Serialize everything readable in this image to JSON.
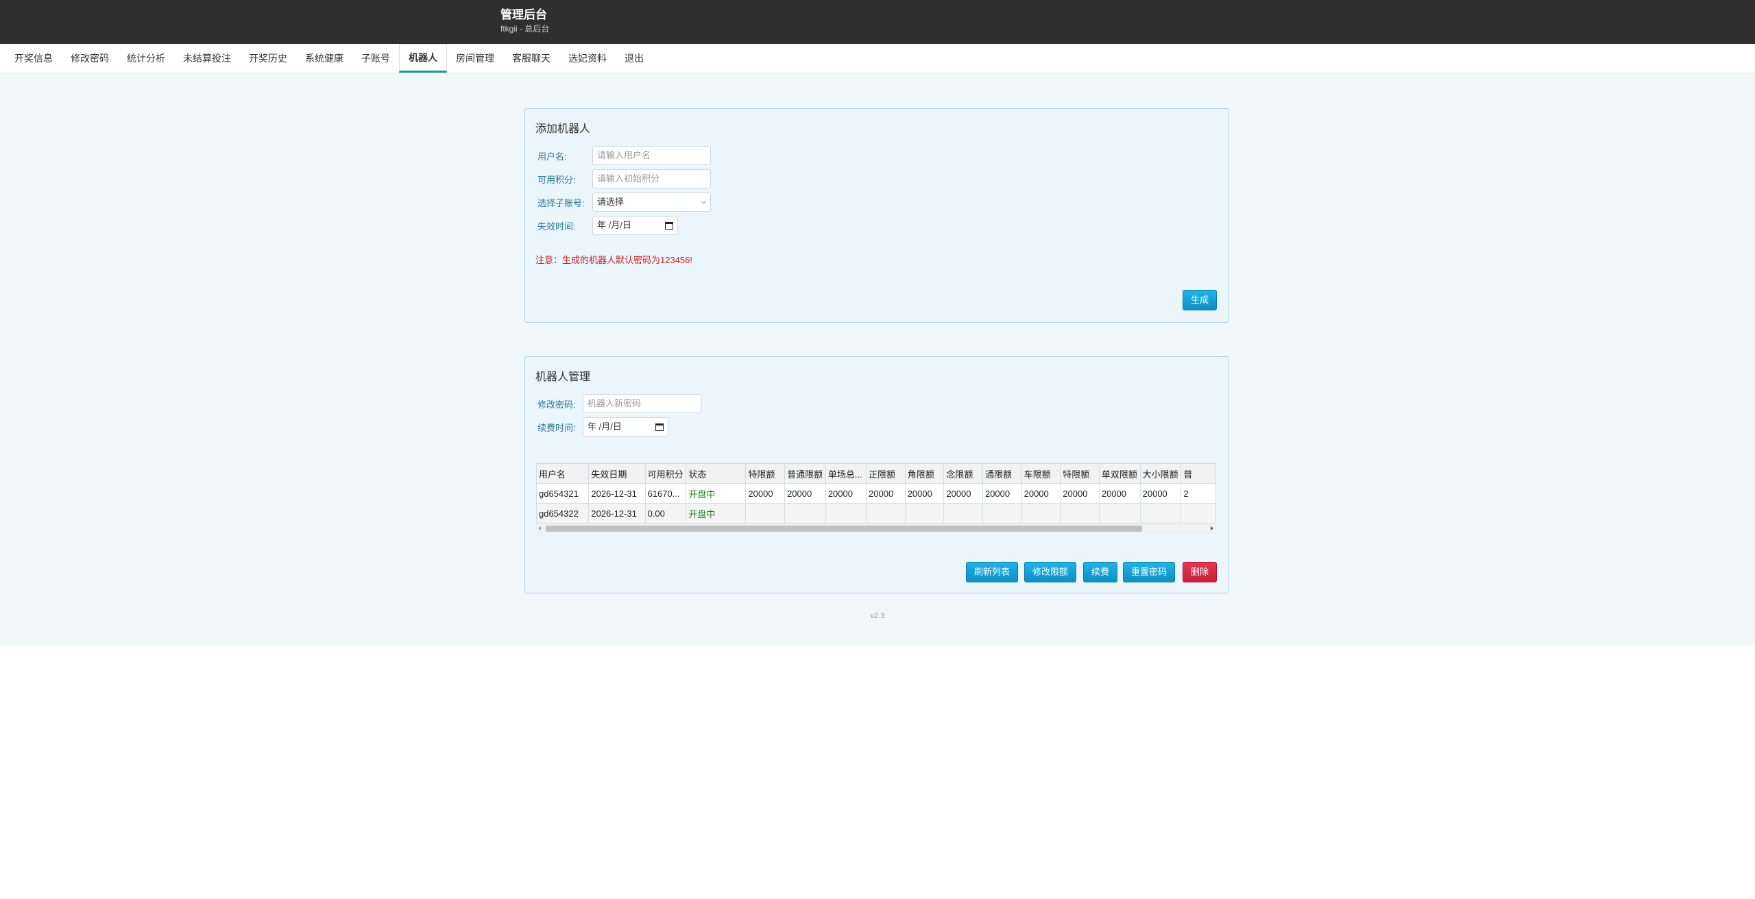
{
  "header": {
    "title": "管理后台",
    "subtitle": "ftkgii - 总后台"
  },
  "nav": {
    "tabs": [
      {
        "label": "开奖信息",
        "active": false
      },
      {
        "label": "修改密码",
        "active": false
      },
      {
        "label": "统计分析",
        "active": false
      },
      {
        "label": "未结算投注",
        "active": false
      },
      {
        "label": "开奖历史",
        "active": false
      },
      {
        "label": "系统健康",
        "active": false
      },
      {
        "label": "子账号",
        "active": false
      },
      {
        "label": "机器人",
        "active": true
      },
      {
        "label": "房间管理",
        "active": false
      },
      {
        "label": "客服聊天",
        "active": false
      },
      {
        "label": "选妃资料",
        "active": false
      },
      {
        "label": "退出",
        "active": false
      }
    ]
  },
  "add_panel": {
    "title": "添加机器人",
    "username": {
      "label": "用户名:",
      "placeholder": "请输入用户名"
    },
    "points": {
      "label": "可用积分:",
      "placeholder": "请输入初始积分"
    },
    "subaccount": {
      "label": "选择子账号:",
      "value": "请选择"
    },
    "expire": {
      "label": "失效时间:",
      "value": "年 /月/日"
    },
    "notice": "注意：生成的机器人默认密码为123456!",
    "generate_label": "生成"
  },
  "manage_panel": {
    "title": "机器人管理",
    "password": {
      "label": "修改密码:",
      "placeholder": "机器人新密码"
    },
    "renew": {
      "label": "续费时间:",
      "value": "年 /月/日"
    },
    "table": {
      "headers": [
        "用户名",
        "失效日期",
        "可用积分",
        "状态",
        "特限额",
        "普通限额",
        "单场总...",
        "正限额",
        "角限额",
        "念限额",
        "通限额",
        "车限额",
        "特限额",
        "单双限额",
        "大小限额",
        "普"
      ],
      "rows": [
        [
          "gd654321",
          "2026-12-31",
          "61670...",
          "开盘中",
          "20000",
          "20000",
          "20000",
          "20000",
          "20000",
          "20000",
          "20000",
          "20000",
          "20000",
          "20000",
          "20000",
          "2"
        ],
        [
          "gd654322",
          "2026-12-31",
          "0.00",
          "开盘中",
          "",
          "",
          "",
          "",
          "",
          "",
          "",
          "",
          "",
          "",
          "",
          ""
        ]
      ]
    },
    "buttons": {
      "refresh": "刷新列表",
      "edit_limit": "修改限额",
      "renew": "续费",
      "reset_password": "重置密码",
      "delete": "删除"
    }
  },
  "footer": {
    "version": "v2.3"
  },
  "colors": {
    "header_bg": "#2f2f2f",
    "active_tab": "#14a37f",
    "primary_button": "#0b90c6",
    "danger_button": "#c81f38",
    "status_open": "#1b8a1b",
    "notice": "#cc1f1f"
  }
}
